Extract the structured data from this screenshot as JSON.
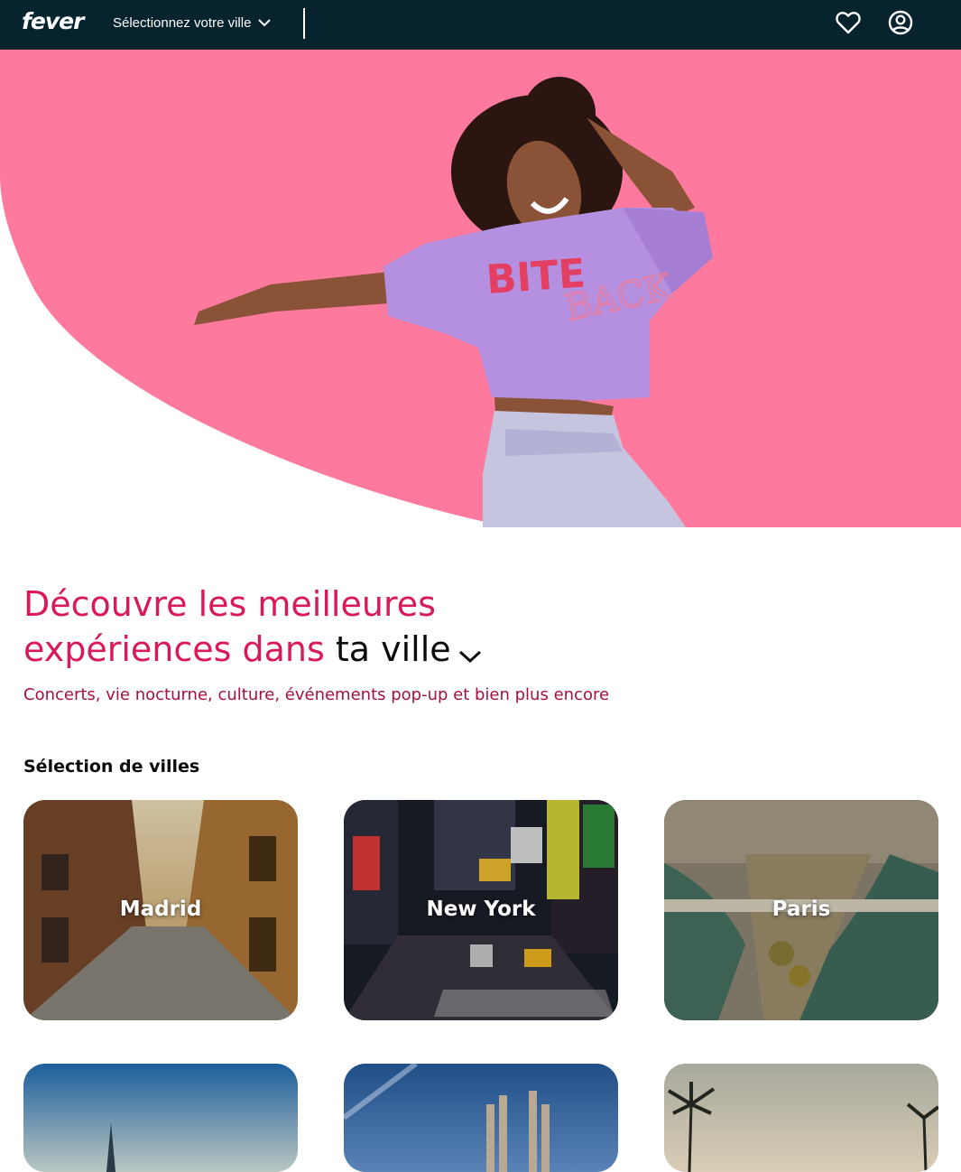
{
  "header": {
    "logo": "fever",
    "city_selector_label": "Sélectionnez votre ville",
    "icons": [
      "heart-icon",
      "user-account-icon",
      "chevron-down-icon"
    ]
  },
  "hero": {
    "shirt_text_1": "BITE",
    "shirt_text_2": "BACK",
    "background_color": "#fd7a9e"
  },
  "headline": {
    "line1": "Découvre les meilleures",
    "line2_prefix": "expériences dans ",
    "city_word": "ta ville",
    "accent_color": "#d9195b"
  },
  "subtitle": "Concerts, vie nocturne, culture, événements pop-up et bien plus encore",
  "cities": {
    "section_title": "Sélection de villes",
    "items": [
      {
        "name": "Madrid"
      },
      {
        "name": "New York"
      },
      {
        "name": "Paris"
      },
      {
        "name": ""
      },
      {
        "name": ""
      },
      {
        "name": ""
      }
    ]
  },
  "colors": {
    "header_bg": "#06232e",
    "pink": "#fd7a9e",
    "headline": "#d9195b",
    "subtitle": "#a4113f"
  }
}
